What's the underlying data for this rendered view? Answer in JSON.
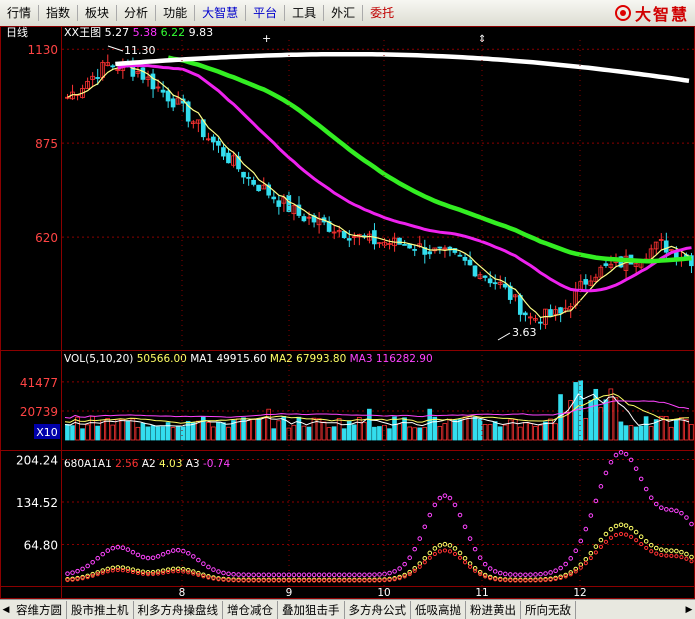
{
  "menu": {
    "items": [
      {
        "label": "行情",
        "style": "normal"
      },
      {
        "label": "指数",
        "style": "normal"
      },
      {
        "label": "板块",
        "style": "normal"
      },
      {
        "label": "分析",
        "style": "normal"
      },
      {
        "label": "功能",
        "style": "normal"
      },
      {
        "label": "大智慧",
        "style": "hl"
      },
      {
        "label": "平台",
        "style": "hl"
      },
      {
        "label": "工具",
        "style": "normal"
      },
      {
        "label": "外汇",
        "style": "normal"
      },
      {
        "label": "委托",
        "style": "red"
      }
    ],
    "logo_text": "大智慧"
  },
  "main": {
    "period": "日线",
    "indicator_name": "XX王图",
    "indicator_values": [
      "5.27",
      "5.38",
      "6.22",
      "9.83"
    ],
    "indicator_colors": [
      "#ffffff",
      "#ff33ff",
      "#33ff33",
      "#ffffff"
    ],
    "high_label": "11.30",
    "low_label": "3.63",
    "y_axis_labels": [
      "1130",
      "875",
      "620"
    ],
    "y_levels": [
      1130,
      875,
      620
    ],
    "y_range": [
      330,
      1155
    ]
  },
  "vol": {
    "title": "VOL(5,10,20)",
    "value": "50566.00",
    "ma_items": [
      {
        "name": "MA1",
        "value": "49915.60",
        "color": "#ffffff"
      },
      {
        "name": "MA2",
        "value": "67993.80",
        "color": "#ffff66"
      },
      {
        "name": "MA3",
        "value": "116282.90",
        "color": "#ff44ff"
      }
    ],
    "y_axis_labels": [
      "41477",
      "20739"
    ],
    "y_levels": [
      41477,
      20739
    ],
    "y_max": 50000,
    "unit_label": "X10"
  },
  "osc": {
    "title": "680A1",
    "a1": {
      "name": "A1",
      "value": "2.56",
      "color": "#ff3333"
    },
    "a2": {
      "name": "A2",
      "value": "4.03",
      "color": "#ffff66"
    },
    "a3": {
      "name": "A3",
      "value": "-0.74",
      "color": "#ff44ff"
    },
    "y_axis_labels": [
      "204.24",
      "134.52",
      "64.80"
    ],
    "y_levels": [
      204.24,
      134.52,
      64.8
    ],
    "y_range": [
      0,
      210
    ]
  },
  "x_axis_labels": [
    "8",
    "9",
    "10",
    "11",
    "12"
  ],
  "tabs": [
    "容维方圆",
    "股市推土机",
    "利多方舟操盘线",
    "增仓减仓",
    "叠加狙击手",
    "多方舟公式",
    "低吸高抛",
    "粉进黄出",
    "所向无敌"
  ],
  "colors": {
    "up": "#ff3333",
    "down": "#33ddee",
    "grid": "#8b0000",
    "ma_white": "#ffffff",
    "ma_magenta": "#ee22ee",
    "ma_green": "#33ee22",
    "ma_yellow": "#ffff88"
  },
  "chart_data": {
    "type": "candlestick",
    "panels": [
      "price",
      "volume",
      "oscillator"
    ],
    "price": {
      "x_labels": [
        "8",
        "9",
        "10",
        "11",
        "12"
      ],
      "y_ticks": [
        1130,
        875,
        620
      ],
      "high": 11.3,
      "low": 3.63,
      "series": [
        {
          "name": "XX王图",
          "values": [
            5.27,
            5.38,
            6.22,
            9.83
          ]
        }
      ]
    },
    "volume": {
      "y_ticks": [
        41477,
        20739
      ],
      "last": 50566.0,
      "ma": {
        "MA1": 49915.6,
        "MA2": 67993.8,
        "MA3": 116282.9
      }
    },
    "oscillator": {
      "y_ticks": [
        204.24,
        134.52,
        64.8
      ],
      "A1": 2.56,
      "A2": 4.03,
      "A3": -0.74
    }
  }
}
